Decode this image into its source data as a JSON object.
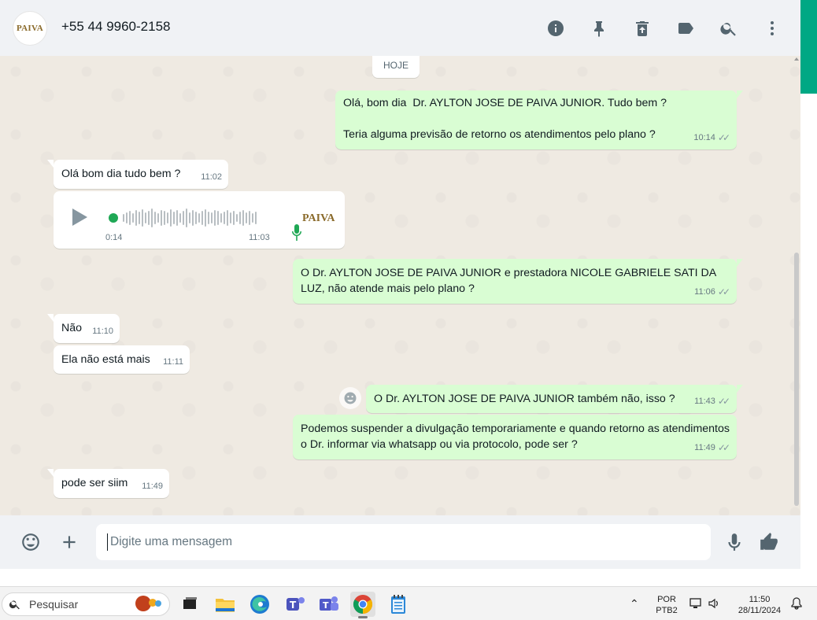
{
  "header": {
    "avatar_logo": "PAIVA",
    "contact_name": "+55 44 9960-2158",
    "icons": [
      "info-icon",
      "pin-icon",
      "delete-icon",
      "label-icon",
      "search-icon",
      "more-vertical-icon"
    ]
  },
  "chat": {
    "date_label": "HOJE",
    "messages": [
      {
        "direction": "out",
        "text": "Olá, bom dia  Dr. AYLTON JOSE DE PAIVA JUNIOR. Tudo bem ?\n\nTeria alguma previsão de retorno os atendimentos pelo plano ?",
        "time": "10:14",
        "status": "read"
      },
      {
        "direction": "in",
        "text": "Olá bom dia tudo bem ?",
        "time": "11:02"
      },
      {
        "direction": "in",
        "type": "audio",
        "duration": "0:14",
        "time": "11:03",
        "sender_logo": "PAIVA"
      },
      {
        "direction": "out",
        "text": "O Dr. AYLTON JOSE DE PAIVA JUNIOR e prestadora NICOLE GABRIELE SATI DA LUZ, não atende mais pelo plano ?",
        "time": "11:06",
        "status": "read"
      },
      {
        "direction": "in",
        "text": "Não",
        "time": "11:10"
      },
      {
        "direction": "in",
        "text": "Ela não está mais",
        "time": "11:11"
      },
      {
        "direction": "out",
        "text": "O Dr. AYLTON JOSE DE PAIVA JUNIOR também não, isso ?",
        "time": "11:43",
        "status": "read"
      },
      {
        "direction": "out",
        "text": "Podemos suspender a divulgação temporariamente e quando retorno as atendimentos o Dr. informar via whatsapp ou via protocolo, pode ser ?",
        "time": "11:49",
        "status": "read"
      },
      {
        "direction": "in",
        "text": "pode ser siim",
        "time": "11:49"
      }
    ]
  },
  "composer": {
    "placeholder": "Digite uma mensagem",
    "value": ""
  },
  "taskbar": {
    "search_label": "Pesquisar",
    "language_line1": "POR",
    "language_line2": "PTB2",
    "time": "11:50",
    "date": "28/11/2024"
  },
  "colors": {
    "outgoing_bubble": "#d9fdd3",
    "incoming_bubble": "#ffffff",
    "chat_background": "#efeae2",
    "accent": "#00a884"
  }
}
